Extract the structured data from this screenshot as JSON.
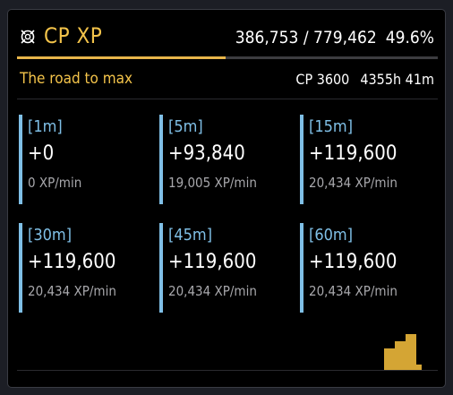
{
  "header": {
    "logo_icon": "cp-emblem-icon",
    "title": "CP XP",
    "xp_progress": "386,753 / 779,462",
    "percent": "49.6%",
    "progress_fraction": 0.496,
    "accent_color": "#f3c34a"
  },
  "subheader": {
    "label": "The road to max",
    "cp_level": "CP 3600",
    "time_remaining": "4355h 41m"
  },
  "cards": [
    {
      "interval": "[1m]",
      "gain": "+0",
      "rate": "0 XP/min"
    },
    {
      "interval": "[5m]",
      "gain": "+93,840",
      "rate": "19,005 XP/min"
    },
    {
      "interval": "[15m]",
      "gain": "+119,600",
      "rate": "20,434 XP/min"
    },
    {
      "interval": "[30m]",
      "gain": "+119,600",
      "rate": "20,434 XP/min"
    },
    {
      "interval": "[45m]",
      "gain": "+119,600",
      "rate": "20,434 XP/min"
    },
    {
      "interval": "[60m]",
      "gain": "+119,600",
      "rate": "20,434 XP/min"
    }
  ],
  "footer": {
    "icon": "bar-chart-icon",
    "icon_color": "#d4a534"
  },
  "colors": {
    "card_accent": "#7fbfe6",
    "muted_text": "#a8a8ac"
  }
}
